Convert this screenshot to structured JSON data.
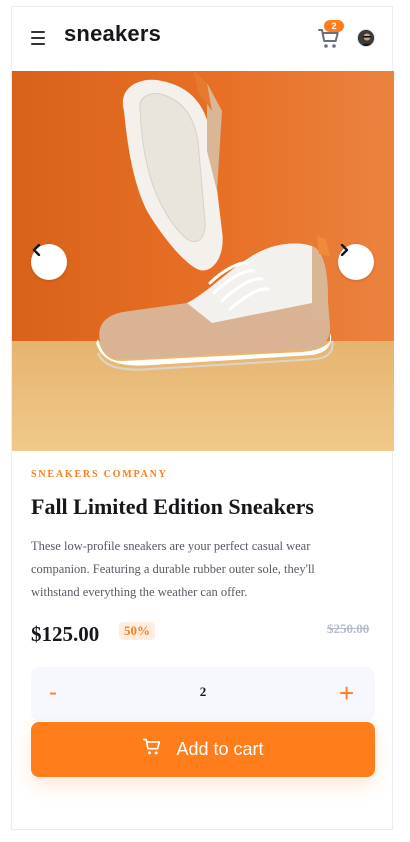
{
  "header": {
    "logo": "sneakers",
    "cart_count": "2"
  },
  "product": {
    "company": "SNEAKERS COMPANY",
    "title": "Fall Limited Edition Sneakers",
    "description": "These low-profile sneakers are your perfect casual wear companion. Featuring a durable rubber outer sole, they'll withstand everything the weather can offer.",
    "price": "$125.00",
    "discount": "50%",
    "old_price": "$250.00"
  },
  "quantity": {
    "minus": "-",
    "value": "2",
    "plus": "+"
  },
  "actions": {
    "add_to_cart": "Add to cart"
  },
  "colors": {
    "accent": "#ff7d1a",
    "accent_light": "#ffede0",
    "dark": "#15171a",
    "muted": "#b6bcc8"
  },
  "icons": {
    "menu": "menu-icon",
    "cart": "cart-icon",
    "avatar": "avatar",
    "prev": "chevron-left-icon",
    "next": "chevron-right-icon"
  }
}
